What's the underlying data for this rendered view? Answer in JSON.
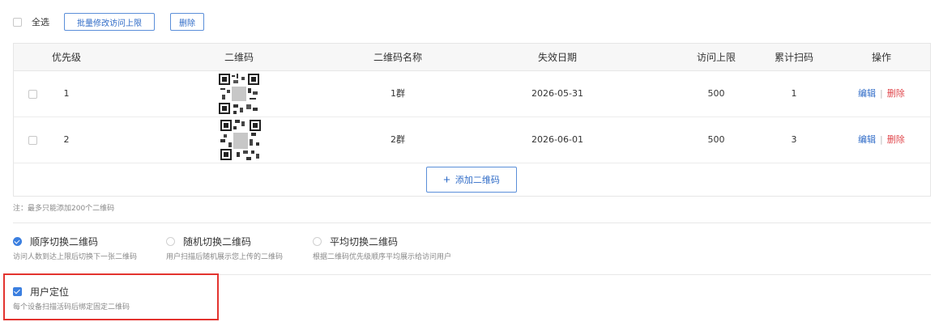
{
  "toolbar": {
    "select_all_label": "全选",
    "batch_button_label": "批量修改访问上限",
    "delete_button_label": "删除"
  },
  "table": {
    "headers": {
      "priority": "优先级",
      "qrcode": "二维码",
      "name": "二维码名称",
      "expiry": "失效日期",
      "limit": "访问上限",
      "scans": "累计扫码",
      "actions": "操作"
    },
    "rows": [
      {
        "priority": "1",
        "name": "1群",
        "expiry": "2026-05-31",
        "limit": "500",
        "scans": "1",
        "edit": "编辑",
        "delete": "删除"
      },
      {
        "priority": "2",
        "name": "2群",
        "expiry": "2026-06-01",
        "limit": "500",
        "scans": "3",
        "edit": "编辑",
        "delete": "删除"
      }
    ],
    "add_button_label": "添加二维码"
  },
  "note": "注：最多只能添加200个二维码",
  "switch_modes": [
    {
      "title": "顺序切换二维码",
      "desc": "访问人数到达上限后切换下一张二维码",
      "checked": true
    },
    {
      "title": "随机切换二维码",
      "desc": "用户扫描后随机展示您上传的二维码",
      "checked": false
    },
    {
      "title": "平均切换二维码",
      "desc": "根据二维码优先级顺序平均展示给访问用户",
      "checked": false
    }
  ],
  "user_locate": {
    "title": "用户定位",
    "desc": "每个设备扫描活码后绑定固定二维码",
    "checked": true
  },
  "colors": {
    "accent": "#3b7fe0",
    "danger": "#e0474c",
    "highlight_border": "#e3342f"
  }
}
